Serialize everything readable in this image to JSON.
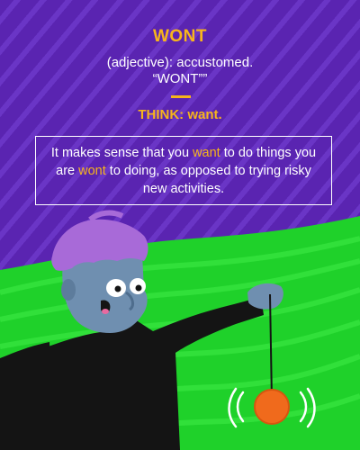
{
  "card": {
    "word": "WONT",
    "definition": "(adjective): accustomed.",
    "pronunciation": "“WONT””",
    "think": "THINK: want.",
    "sentence": {
      "part1": "It makes sense that you ",
      "highlight1": "want",
      "part2": " to do things you are ",
      "highlight2": "wont",
      "part3": " to doing, as opposed to trying risky new activities."
    }
  },
  "colors": {
    "background_purple": "#5b25b3",
    "accent_yellow": "#f7b51b",
    "ground_green": "#1fd12a",
    "character_black": "#141414",
    "skin_blue": "#6f8fb0",
    "hair_purple": "#a86ad8",
    "yoyo_orange": "#f06a1c"
  },
  "icons": [
    "cartoon-character",
    "yoyo-icon",
    "motion-lines"
  ]
}
